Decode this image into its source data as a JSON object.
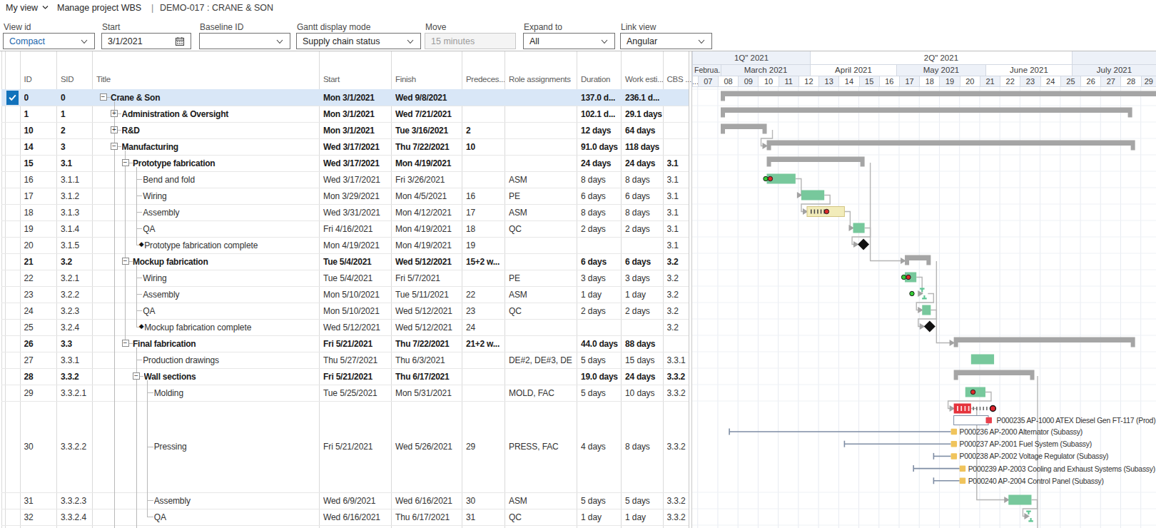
{
  "topbar": {
    "menu_label": "My view",
    "title": "Manage project WBS",
    "separator": "|",
    "context": "DEMO-017 : CRANE & SON"
  },
  "toolbar": {
    "fields": [
      {
        "name": "view-id",
        "label": "View id",
        "value": "Compact",
        "type": "select",
        "accent": true
      },
      {
        "name": "start-date",
        "label": "Start",
        "value": "3/1/2021",
        "type": "date"
      },
      {
        "name": "baseline-id",
        "label": "Baseline ID",
        "value": "",
        "type": "select"
      },
      {
        "name": "gantt-display-mode",
        "label": "Gantt display mode",
        "value": "Supply chain status",
        "type": "select"
      },
      {
        "name": "move",
        "label": "Move",
        "value": "15 minutes",
        "type": "text",
        "disabled": true
      },
      {
        "name": "expand-to",
        "label": "Expand to",
        "value": "All",
        "type": "select"
      },
      {
        "name": "link-view",
        "label": "Link view",
        "value": "Angular",
        "type": "select"
      }
    ]
  },
  "grid": {
    "columns": [
      {
        "key": "check",
        "label": ""
      },
      {
        "key": "id",
        "label": "ID"
      },
      {
        "key": "sid",
        "label": "SID"
      },
      {
        "key": "title",
        "label": "Title"
      },
      {
        "key": "start",
        "label": "Start"
      },
      {
        "key": "finish",
        "label": "Finish"
      },
      {
        "key": "pred",
        "label": "Predeces..."
      },
      {
        "key": "roles",
        "label": "Role assignments"
      },
      {
        "key": "dur",
        "label": "Duration"
      },
      {
        "key": "work",
        "label": "Work esti..."
      },
      {
        "key": "cbs",
        "label": "CBS ..."
      }
    ],
    "rows": [
      {
        "id": "0",
        "sid": "0",
        "title": "Crane & Son",
        "level": 0,
        "kind": "summary",
        "expander": "-",
        "start": "Mon 3/1/2021",
        "finish": "Wed 9/8/2021",
        "pred": "",
        "roles": "",
        "dur": "137.0 d...",
        "work": "236.1 d...",
        "cbs": "",
        "selected": true,
        "checked": true
      },
      {
        "id": "1",
        "sid": "1",
        "title": "Administration & Oversight",
        "level": 1,
        "kind": "summary",
        "expander": "+",
        "start": "Mon 3/1/2021",
        "finish": "Wed 7/21/2021",
        "pred": "",
        "roles": "",
        "dur": "102.1 d...",
        "work": "29.1 days",
        "cbs": ""
      },
      {
        "id": "10",
        "sid": "2",
        "title": "R&D",
        "level": 1,
        "kind": "summary",
        "expander": "+",
        "start": "Mon 3/1/2021",
        "finish": "Tue 3/16/2021",
        "pred": "2",
        "roles": "",
        "dur": "12 days",
        "work": "64 days",
        "cbs": ""
      },
      {
        "id": "14",
        "sid": "3",
        "title": "Manufacturing",
        "level": 1,
        "kind": "summary",
        "expander": "-",
        "start": "Wed 3/17/2021",
        "finish": "Thu 7/22/2021",
        "pred": "10",
        "roles": "",
        "dur": "91.0 days",
        "work": "118 days",
        "cbs": ""
      },
      {
        "id": "15",
        "sid": "3.1",
        "title": "Prototype fabrication",
        "level": 2,
        "kind": "summary",
        "expander": "-",
        "start": "Wed 3/17/2021",
        "finish": "Mon 4/19/2021",
        "pred": "",
        "roles": "",
        "dur": "24 days",
        "work": "24 days",
        "cbs": "3.1"
      },
      {
        "id": "16",
        "sid": "3.1.1",
        "title": "Bend and fold",
        "level": 3,
        "kind": "task",
        "start": "Wed 3/17/2021",
        "finish": "Fri 3/26/2021",
        "pred": "",
        "roles": "ASM",
        "dur": "8 days",
        "work": "8 days",
        "cbs": "3.1"
      },
      {
        "id": "17",
        "sid": "3.1.2",
        "title": "Wiring",
        "level": 3,
        "kind": "task",
        "start": "Mon 3/29/2021",
        "finish": "Mon 4/5/2021",
        "pred": "16",
        "roles": "PE",
        "dur": "6 days",
        "work": "6 days",
        "cbs": "3.1"
      },
      {
        "id": "18",
        "sid": "3.1.3",
        "title": "Assembly",
        "level": 3,
        "kind": "task",
        "start": "Wed 3/31/2021",
        "finish": "Mon 4/12/2021",
        "pred": "17",
        "roles": "ASM",
        "dur": "8 days",
        "work": "8 days",
        "cbs": "3.1"
      },
      {
        "id": "19",
        "sid": "3.1.4",
        "title": "QA",
        "level": 3,
        "kind": "task",
        "start": "Fri 4/16/2021",
        "finish": "Mon 4/19/2021",
        "pred": "18",
        "roles": "QC",
        "dur": "2 days",
        "work": "2 days",
        "cbs": "3.1"
      },
      {
        "id": "20",
        "sid": "3.1.5",
        "title": "Prototype fabrication complete",
        "level": 3,
        "kind": "milestone",
        "start": "Mon 4/19/2021",
        "finish": "Mon 4/19/2021",
        "pred": "19",
        "roles": "",
        "dur": "",
        "work": "",
        "cbs": "3.1"
      },
      {
        "id": "21",
        "sid": "3.2",
        "title": "Mockup fabrication",
        "level": 2,
        "kind": "summary",
        "expander": "-",
        "start": "Tue 5/4/2021",
        "finish": "Wed 5/12/2021",
        "pred": "15+2 w...",
        "roles": "",
        "dur": "6 days",
        "work": "6 days",
        "cbs": "3.2"
      },
      {
        "id": "22",
        "sid": "3.2.1",
        "title": "Wiring",
        "level": 3,
        "kind": "task",
        "start": "Tue 5/4/2021",
        "finish": "Fri 5/7/2021",
        "pred": "",
        "roles": "PE",
        "dur": "3 days",
        "work": "3 days",
        "cbs": "3.2"
      },
      {
        "id": "23",
        "sid": "3.2.2",
        "title": "Assembly",
        "level": 3,
        "kind": "task",
        "start": "Mon 5/10/2021",
        "finish": "Tue 5/11/2021",
        "pred": "22",
        "roles": "ASM",
        "dur": "1 day",
        "work": "1 day",
        "cbs": "3.2"
      },
      {
        "id": "24",
        "sid": "3.2.3",
        "title": "QA",
        "level": 3,
        "kind": "task",
        "start": "Mon 5/10/2021",
        "finish": "Wed 5/12/2021",
        "pred": "23",
        "roles": "QC",
        "dur": "2 days",
        "work": "2 days",
        "cbs": "3.2"
      },
      {
        "id": "25",
        "sid": "3.2.4",
        "title": "Mockup fabrication complete",
        "level": 3,
        "kind": "milestone",
        "start": "Wed 5/12/2021",
        "finish": "Wed 5/12/2021",
        "pred": "24",
        "roles": "",
        "dur": "",
        "work": "",
        "cbs": "3.2"
      },
      {
        "id": "26",
        "sid": "3.3",
        "title": "Final fabrication",
        "level": 2,
        "kind": "summary",
        "expander": "-",
        "start": "Fri 5/21/2021",
        "finish": "Thu 7/22/2021",
        "pred": "21+2 w...",
        "roles": "",
        "dur": "44.0 days",
        "work": "88 days",
        "cbs": ""
      },
      {
        "id": "27",
        "sid": "3.3.1",
        "title": "Production drawings",
        "level": 3,
        "kind": "task",
        "start": "Thu 5/27/2021",
        "finish": "Thu 6/3/2021",
        "pred": "",
        "roles": "DE#2, DE#3, DE",
        "dur": "5 days",
        "work": "15 days",
        "cbs": "3.3.1"
      },
      {
        "id": "28",
        "sid": "3.3.2",
        "title": "Wall sections",
        "level": 3,
        "kind": "summary",
        "expander": "-",
        "start": "Fri 5/21/2021",
        "finish": "Thu 6/17/2021",
        "pred": "",
        "roles": "",
        "dur": "19.0 days",
        "work": "24 days",
        "cbs": "3.3.2"
      },
      {
        "id": "29",
        "sid": "3.3.2.1",
        "title": "Molding",
        "level": 4,
        "kind": "task",
        "start": "Tue 5/25/2021",
        "finish": "Mon 5/31/2021",
        "pred": "",
        "roles": "MOLD, FAC",
        "dur": "5 days",
        "work": "10 days",
        "cbs": "3.3.2"
      },
      {
        "id": "30",
        "sid": "3.3.2.2",
        "title": "Pressing",
        "level": 4,
        "kind": "task",
        "tall": true,
        "start": "Fri 5/21/2021",
        "finish": "Wed 5/26/2021",
        "pred": "29",
        "roles": "PRESS, FAC",
        "dur": "4 days",
        "work": "8 days",
        "cbs": "3.3.2"
      },
      {
        "id": "31",
        "sid": "3.3.2.3",
        "title": "Assembly",
        "level": 4,
        "kind": "task",
        "start": "Wed 6/9/2021",
        "finish": "Wed 6/16/2021",
        "pred": "30",
        "roles": "ASM",
        "dur": "5 days",
        "work": "5 days",
        "cbs": "3.3.2"
      },
      {
        "id": "32",
        "sid": "3.3.2.4",
        "title": "QA",
        "level": 4,
        "kind": "task",
        "start": "Wed 6/16/2021",
        "finish": "Thu 6/17/2021",
        "pred": "31",
        "roles": "QC",
        "dur": "1 day",
        "work": "1 day",
        "cbs": "3.3.2"
      }
    ]
  },
  "gantt": {
    "timescale": {
      "quarters": [
        {
          "label": "1Q\" 2021",
          "from": "2021-02-19",
          "to": "2021-04-01",
          "shaded": true
        },
        {
          "label": "2Q\" 2021",
          "from": "2021-04-01",
          "to": "2021-07-01",
          "shaded": false
        },
        {
          "label": "",
          "from": "2021-07-01",
          "to": "2021-08-02",
          "shaded": true
        }
      ],
      "months": [
        {
          "label": "Februa...",
          "from": "2021-02-19",
          "to": "2021-03-01",
          "shaded": true
        },
        {
          "label": "March 2021",
          "from": "2021-03-01",
          "to": "2021-04-01",
          "shaded": true
        },
        {
          "label": "April 2021",
          "from": "2021-04-01",
          "to": "2021-05-01",
          "shaded": false
        },
        {
          "label": "May 2021",
          "from": "2021-05-01",
          "to": "2021-06-01",
          "shaded": true
        },
        {
          "label": "June 2021",
          "from": "2021-06-01",
          "to": "2021-07-01",
          "shaded": false
        },
        {
          "label": "July 2021",
          "from": "2021-07-01",
          "to": "2021-08-02",
          "shaded": true
        }
      ],
      "week_first_sunday": "2021-02-21",
      "week_labels": [
        "07",
        "08",
        "09",
        "10",
        "11",
        "12",
        "13",
        "14",
        "15",
        "16",
        "17",
        "18",
        "19",
        "20",
        "21",
        "22",
        "23",
        "24",
        "25",
        "26",
        "27",
        "28",
        "29"
      ],
      "week_partial_label": "..."
    },
    "bars": [
      {
        "row": 0,
        "type": "summary",
        "start": "2021-03-01",
        "end": "2021-09-09",
        "clip_right": true
      },
      {
        "row": 1,
        "type": "summary",
        "start": "2021-03-01",
        "end": "2021-07-22"
      },
      {
        "row": 2,
        "type": "summary",
        "start": "2021-03-01",
        "end": "2021-03-17"
      },
      {
        "row": 3,
        "type": "summary",
        "start": "2021-03-17",
        "end": "2021-07-23"
      },
      {
        "row": 4,
        "type": "summary",
        "start": "2021-03-17",
        "end": "2021-04-20"
      },
      {
        "row": 5,
        "type": "task",
        "start": "2021-03-17",
        "end": "2021-03-27",
        "dots": [
          "green",
          "red"
        ]
      },
      {
        "row": 6,
        "type": "task",
        "start": "2021-03-29",
        "end": "2021-04-06"
      },
      {
        "row": 7,
        "type": "task-warn",
        "start": "2021-03-31",
        "end": "2021-04-13",
        "hatches": 5,
        "red_dot_offset": 27.5
      },
      {
        "row": 8,
        "type": "task",
        "start": "2021-04-16",
        "end": "2021-04-20"
      },
      {
        "row": 9,
        "type": "milestone",
        "start": "2021-04-19",
        "end": "2021-04-19"
      },
      {
        "row": 10,
        "type": "summary",
        "start": "2021-05-04",
        "end": "2021-05-13"
      },
      {
        "row": 11,
        "type": "task",
        "start": "2021-05-04",
        "end": "2021-05-08",
        "dots": [
          "green",
          "red"
        ]
      },
      {
        "row": 12,
        "type": "tiny",
        "start": "2021-05-10",
        "end": "2021-05-12",
        "dots": [
          "green"
        ]
      },
      {
        "row": 13,
        "type": "task",
        "start": "2021-05-10",
        "end": "2021-05-13"
      },
      {
        "row": 14,
        "type": "milestone",
        "start": "2021-05-12",
        "end": "2021-05-12"
      },
      {
        "row": 15,
        "type": "summary",
        "start": "2021-05-21",
        "end": "2021-07-23"
      },
      {
        "row": 16,
        "type": "task",
        "start": "2021-05-27",
        "end": "2021-06-04"
      },
      {
        "row": 17,
        "type": "summary",
        "start": "2021-05-21",
        "end": "2021-06-18"
      },
      {
        "row": 18,
        "type": "task",
        "start": "2021-05-25",
        "end": "2021-06-01",
        "red_dot_offset": 10.8
      },
      {
        "row": 19,
        "type": "task-late",
        "start": "2021-05-21",
        "end": "2021-05-27",
        "white_hatches": 4,
        "trail_dashes": 5,
        "red_dot_end": true
      },
      {
        "row": 20,
        "type": "task",
        "start": "2021-06-09",
        "end": "2021-06-17"
      },
      {
        "row": 21,
        "type": "tiny",
        "start": "2021-06-16",
        "end": "2021-06-18"
      }
    ],
    "links": [
      {
        "from": 2,
        "to": 3
      },
      {
        "from": 5,
        "to": 6
      },
      {
        "from": 6,
        "to": 7
      },
      {
        "from": 7,
        "to": 8
      },
      {
        "from": 8,
        "to": 9
      },
      {
        "from": 4,
        "to": 10
      },
      {
        "from": 11,
        "to": 12
      },
      {
        "from": 12,
        "to": 13
      },
      {
        "from": 13,
        "to": 14
      },
      {
        "from": 10,
        "to": 15
      },
      {
        "from": 18,
        "to": 19
      },
      {
        "from": 19,
        "to": 20
      },
      {
        "from": 20,
        "to": 21
      },
      {
        "from": 17,
        "to": -1
      }
    ],
    "supply_items": [
      {
        "kind": "order",
        "label": "P000235 AP-1000 ATEX Diesel Gen FT-117 (Prod)",
        "bar_start": "2021-05-21",
        "bar_end": "2021-06-02",
        "marker": "red-square"
      },
      {
        "kind": "whisker",
        "label": "P000236 AP-2000 Alternator (Subassy)",
        "line_start": "2021-03-04",
        "line_end": "2021-05-20",
        "marker": "yellow-square"
      },
      {
        "kind": "whisker",
        "label": "P000237 AP-2001 Fuel System (Subassy)",
        "line_start": "2021-04-13",
        "line_end": "2021-05-20",
        "marker": "yellow-square"
      },
      {
        "kind": "whisker",
        "label": "P000238 AP-2002 Voltage Regulator (Subassy)",
        "line_start": "2021-05-14",
        "line_end": "2021-05-20",
        "marker": "yellow-square"
      },
      {
        "kind": "whisker",
        "label": "P000239 AP-2003 Cooling and Exhaust Systems (Subassy)",
        "line_start": "2021-05-07",
        "line_end": "2021-05-23",
        "marker": "yellow-square"
      },
      {
        "kind": "whisker",
        "label": "P000240 AP-2004 Control Panel (Subassy)",
        "line_start": "2021-05-14",
        "line_end": "2021-05-23",
        "marker": "yellow-square"
      }
    ],
    "colors": {
      "summary": "#a5a5a5",
      "task": "#77c89c",
      "warn_fill": "#f2ecba",
      "warn_border": "#d2c483",
      "late": "#e5333c",
      "milestone": "#111111",
      "link": "#b5b5b5",
      "arrow": "#a2a2a2",
      "dot_green": "#35cd35",
      "dot_red": "#de2b2b",
      "whisker": "#7e8da4",
      "yellow_square": "#f0c45c",
      "red_square": "#e8414d",
      "handle": "#5ec593"
    }
  }
}
